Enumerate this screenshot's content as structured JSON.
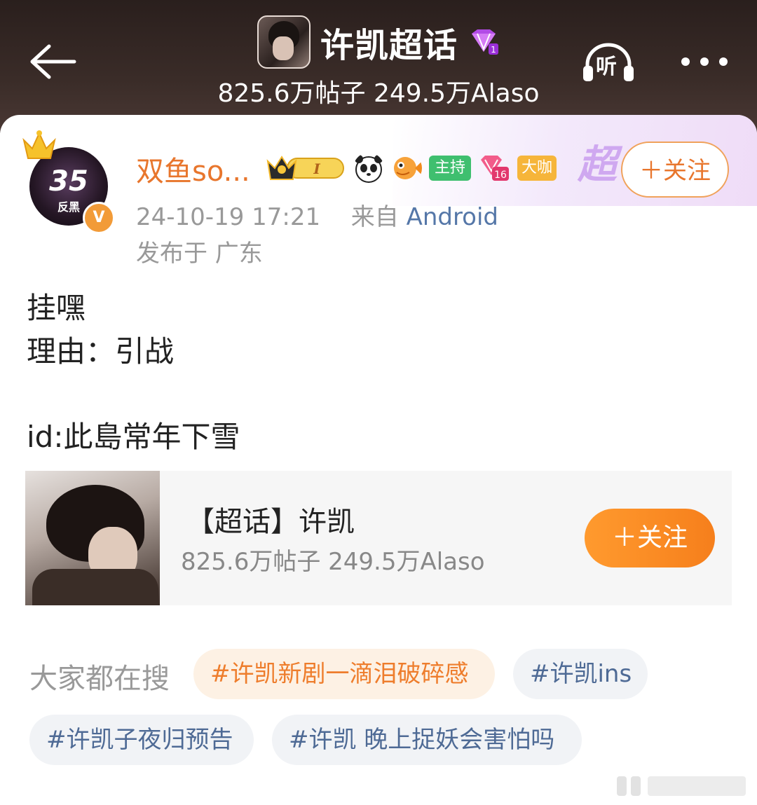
{
  "header": {
    "title": "许凯超话",
    "stats": "825.6万帖子 249.5万Alaso",
    "listen_label": "听"
  },
  "post": {
    "author": {
      "name": "双鱼so...",
      "avatar_text": "35",
      "avatar_subtext": "反黑",
      "verified_mark": "V",
      "badges": {
        "host": "主持",
        "level": "16",
        "daka": "大咖",
        "crown_level": "I"
      }
    },
    "super_mark": "超",
    "follow_label": "＋关注",
    "time": "24-10-19 17:21",
    "source_prefix": "来自",
    "source": "Android",
    "location": "发布于 广东",
    "lines": [
      "挂嘿",
      "理由：引战",
      "id:此島常年下雪"
    ]
  },
  "topic_card": {
    "title": "【超话】许凯",
    "stats": "825.6万帖子 249.5万Alaso",
    "follow_label": "＋关注"
  },
  "search": {
    "label": "大家都在搜",
    "chips": [
      "#许凯新剧一滴泪破碎感",
      "#许凯ins",
      "#许凯子夜归预告",
      "#许凯 晚上捉妖会害怕吗"
    ]
  },
  "colors": {
    "accent_orange": "#e8762d",
    "link_blue": "#4e6a95",
    "header_bg": "#2a1f1d",
    "host_green": "#3fbf6f"
  }
}
